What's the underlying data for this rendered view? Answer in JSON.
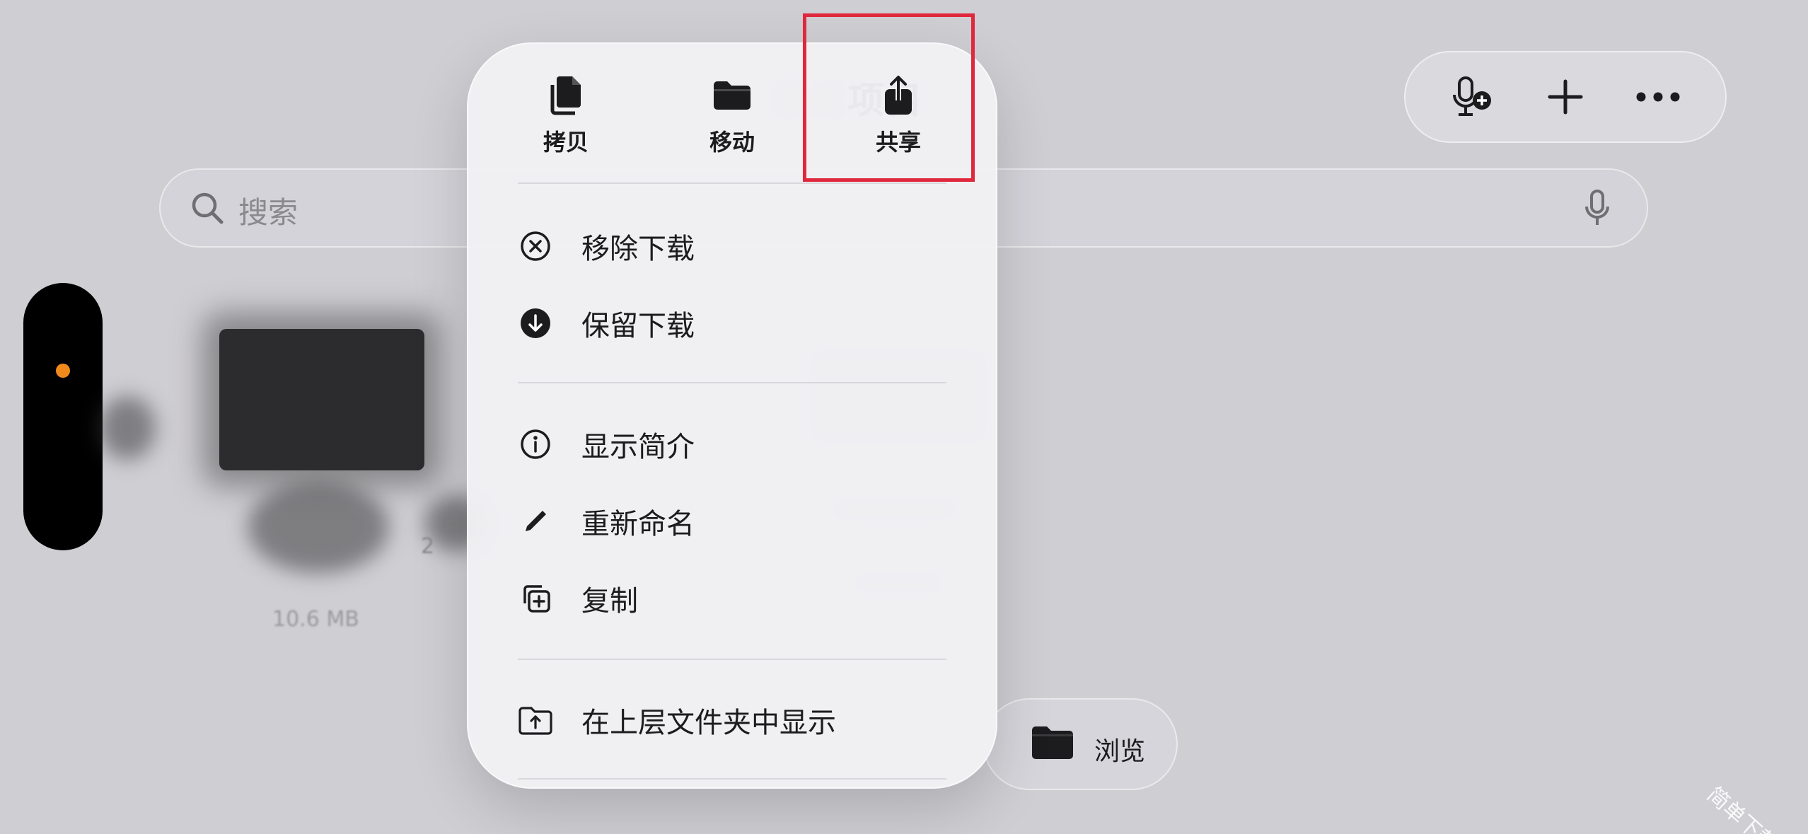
{
  "header": {
    "title_visible": "项目"
  },
  "toolbar": {
    "buttons": [
      {
        "name": "voice-add",
        "icon": "mic-plus-icon"
      },
      {
        "name": "add",
        "icon": "plus-icon"
      },
      {
        "name": "more",
        "icon": "ellipsis-icon"
      }
    ]
  },
  "search": {
    "placeholder": "搜索"
  },
  "file": {
    "size": "10.6 MB",
    "count": "2"
  },
  "browse": {
    "label": "浏览"
  },
  "context_menu": {
    "top_actions": [
      {
        "label": "拷贝",
        "icon": "doc-on-doc-icon"
      },
      {
        "label": "移动",
        "icon": "folder-icon"
      },
      {
        "label": "共享",
        "icon": "share-icon",
        "highlighted": true
      }
    ],
    "items": [
      {
        "label": "移除下载",
        "icon": "xmark-circle-icon"
      },
      {
        "label": "保留下载",
        "icon": "arrow-down-circle-icon"
      },
      {
        "label": "显示简介",
        "icon": "info-circle-icon"
      },
      {
        "label": "重新命名",
        "icon": "pencil-icon"
      },
      {
        "label": "复制",
        "icon": "plus-square-on-square-icon"
      },
      {
        "label": "在上层文件夹中显示",
        "icon": "folder-arrow-up-icon"
      }
    ]
  },
  "colors": {
    "highlight": "#e0283c",
    "status_dot": "#f08a1c",
    "background": "#cfced3"
  },
  "watermark": "简单下载站"
}
